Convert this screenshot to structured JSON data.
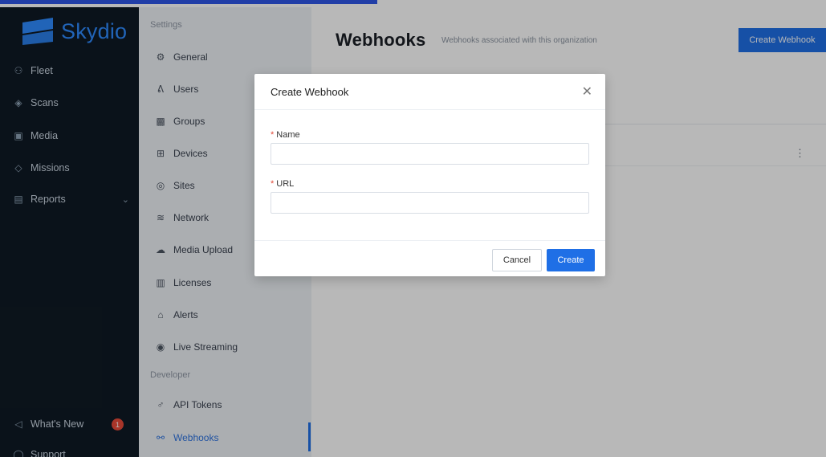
{
  "app": {
    "brand": "Skydio"
  },
  "sidebar": {
    "items": [
      {
        "label": "Fleet",
        "icon": "fleet-icon"
      },
      {
        "label": "Scans",
        "icon": "scans-icon"
      },
      {
        "label": "Media",
        "icon": "media-icon"
      },
      {
        "label": "Missions",
        "icon": "missions-icon"
      },
      {
        "label": "Reports",
        "icon": "reports-icon"
      }
    ],
    "whats_new": "What's New",
    "whats_new_badge": "1",
    "bottom_partial": "Support"
  },
  "settings": {
    "title": "Settings",
    "items": [
      {
        "label": "General",
        "icon": "gear-icon"
      },
      {
        "label": "Users",
        "icon": "users-icon"
      },
      {
        "label": "Groups",
        "icon": "groups-icon"
      },
      {
        "label": "Devices",
        "icon": "devices-icon"
      },
      {
        "label": "Sites",
        "icon": "sites-icon"
      },
      {
        "label": "Network",
        "icon": "wifi-icon"
      },
      {
        "label": "Media Upload",
        "icon": "cloud-upload-icon"
      },
      {
        "label": "Licenses",
        "icon": "licenses-icon"
      },
      {
        "label": "Alerts",
        "icon": "bell-icon"
      },
      {
        "label": "Live Streaming",
        "icon": "live-stream-icon"
      }
    ],
    "developer_title": "Developer",
    "developer_items": [
      {
        "label": "API Tokens",
        "icon": "key-icon"
      },
      {
        "label": "Webhooks",
        "icon": "webhook-icon"
      }
    ]
  },
  "main": {
    "title": "Webhooks",
    "subtitle": "Webhooks associated with this organization",
    "create_button": "Create Webhook"
  },
  "modal": {
    "title": "Create Webhook",
    "fields": [
      {
        "label": "Name",
        "value": ""
      },
      {
        "label": "URL",
        "value": ""
      }
    ],
    "cancel": "Cancel",
    "create": "Create"
  },
  "colors": {
    "primary": "#1f6fe6",
    "sidebar_bg": "#0f1a24",
    "settings_bg": "#eef1f5",
    "brand": "#2e8bff",
    "danger": "#e84a3a"
  }
}
